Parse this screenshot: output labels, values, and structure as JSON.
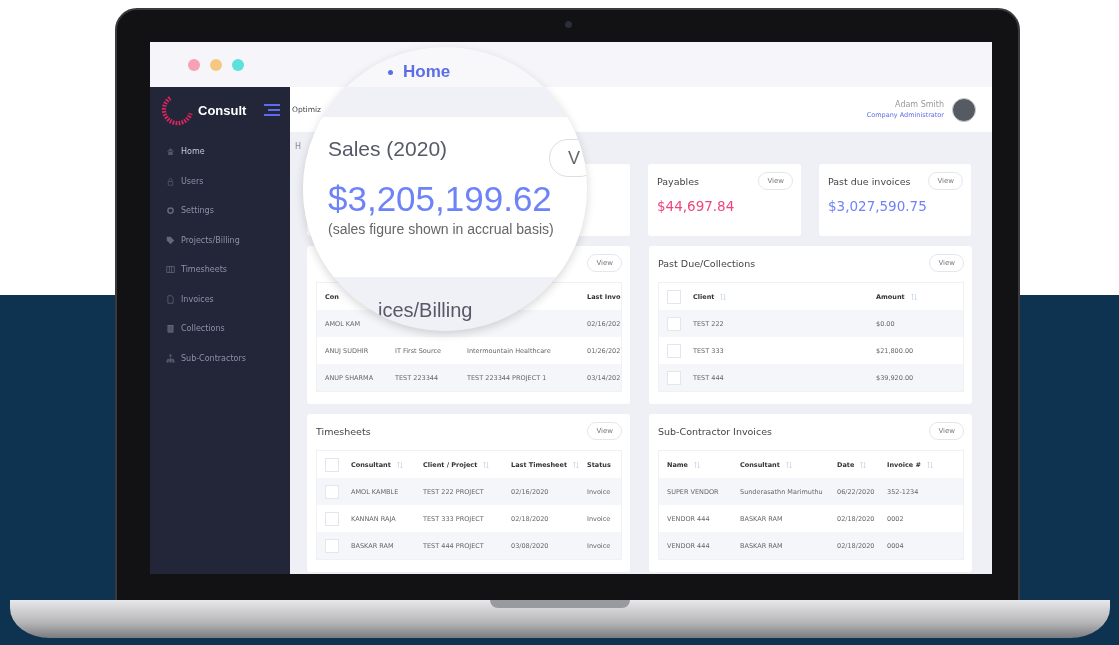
{
  "window_controls": [
    {
      "color": "#f7a1b5"
    },
    {
      "color": "#f5c882"
    },
    {
      "color": "#5ee0dc"
    }
  ],
  "sidebar": {
    "brand": "Consult",
    "items": [
      {
        "label": "Home",
        "kind": "home",
        "selected": true
      },
      {
        "label": "Users",
        "kind": "user",
        "selected": false
      },
      {
        "label": "Settings",
        "kind": "gear",
        "selected": false
      },
      {
        "label": "Projects/Billing",
        "kind": "tag",
        "selected": false
      },
      {
        "label": "Timesheets",
        "kind": "columns",
        "selected": false
      },
      {
        "label": "Invoices",
        "kind": "file",
        "selected": false
      },
      {
        "label": "Collections",
        "kind": "trash",
        "selected": false
      },
      {
        "label": "Sub-Contractors",
        "kind": "tree",
        "selected": false
      }
    ]
  },
  "topbar": {
    "title": "Optimiz",
    "user_name": "Adam Smith",
    "user_role": "Company Administrator"
  },
  "breadcrumb": "H",
  "magnifier": {
    "nav": "Home",
    "title": "Sales (2020)",
    "amount": "$3,205,199.62",
    "caption": "(sales figure shown in accrual basis)",
    "button": "V",
    "section": "ices/Billing"
  },
  "stats": [
    {
      "title": "Payables",
      "amount": "$44,697.84",
      "color": "#f0457a",
      "button": "View"
    },
    {
      "title": "Past due invoices",
      "amount": "$3,027,590.75",
      "color": "#6e83f7",
      "button": "View"
    }
  ],
  "invoices": {
    "button": "View",
    "header": {
      "consultant": "Con",
      "last_invoice": "Last Invo"
    },
    "rows": [
      {
        "consultant": "AMOL KAM",
        "last_invoice": "02/16/202"
      },
      {
        "consultant": "ANUJ SUDHIR",
        "client": "IT First Source",
        "project": "Intermountain Healthcare",
        "last_invoice": "01/26/202"
      },
      {
        "consultant": "ANUP SHARMA",
        "client": "TEST 223344",
        "project": "TEST 223344 PROJECT 1",
        "last_invoice": "03/14/202"
      }
    ]
  },
  "collections": {
    "title": "Past Due/Collections",
    "button": "View",
    "all_checked": false,
    "columns": [
      "Client",
      "Amount"
    ],
    "rows": [
      {
        "cells": [
          "TEST 222",
          "$0.00"
        ],
        "checked": false
      },
      {
        "cells": [
          "TEST 333",
          "$21,800.00"
        ],
        "checked": false
      },
      {
        "cells": [
          "TEST 444",
          "$39,920.00"
        ],
        "checked": false
      }
    ]
  },
  "timesheets": {
    "title": "Timesheets",
    "button": "View",
    "all_checked": false,
    "columns": [
      "Consultant",
      "Client / Project",
      "Last Timesheet",
      "Status"
    ],
    "rows": [
      {
        "cells": [
          "AMOL KAMBLE",
          "TEST 222 PROJECT",
          "02/16/2020",
          "Invoice"
        ],
        "checked": false
      },
      {
        "cells": [
          "KANNAN RAJA",
          "TEST 333 PROJECT",
          "02/18/2020",
          "Invoice"
        ],
        "checked": false
      },
      {
        "cells": [
          "BASKAR RAM",
          "TEST 444 PROJECT",
          "03/08/2020",
          "Invoice"
        ],
        "checked": false
      }
    ]
  },
  "subcontractor_invoices": {
    "title": "Sub-Contractor Invoices",
    "button": "View",
    "columns": [
      "Name",
      "Consultant",
      "Date",
      "Invoice #"
    ],
    "rows": [
      {
        "cells": [
          "SUPER VENDOR",
          "Sunderasathn Marimuthu",
          "06/22/2020",
          "352-1234"
        ]
      },
      {
        "cells": [
          "VENDOR 444",
          "BASKAR RAM",
          "02/18/2020",
          "0002"
        ]
      },
      {
        "cells": [
          "VENDOR 444",
          "BASKAR RAM",
          "02/18/2020",
          "0004"
        ]
      }
    ]
  }
}
